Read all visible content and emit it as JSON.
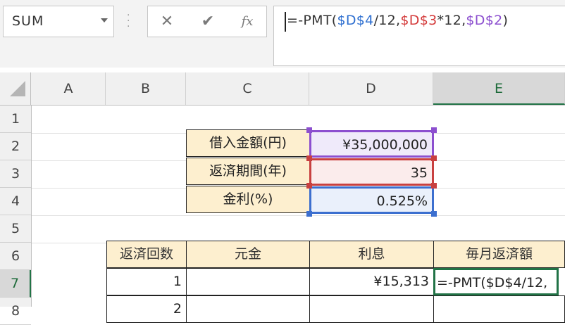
{
  "name_box": {
    "value": "SUM"
  },
  "formula_buttons": {
    "cancel": "✕",
    "enter": "✔",
    "fx": "fx"
  },
  "formula": {
    "parts": [
      "=-PMT(",
      "$D$4",
      "/12,",
      "$D$3",
      "*12,",
      "$D$2",
      ")"
    ]
  },
  "columns": [
    "A",
    "B",
    "C",
    "D",
    "E"
  ],
  "rows": [
    "1",
    "2",
    "3",
    "4",
    "5",
    "6",
    "7",
    "8"
  ],
  "loan_table": [
    {
      "label": "借入金額(円)",
      "value": "¥35,000,000"
    },
    {
      "label": "返済期間(年)",
      "value": "35"
    },
    {
      "label": "金利(%)",
      "value": "0.525%"
    }
  ],
  "schedule_headers": [
    "返済回数",
    "元金",
    "利息",
    "毎月返済額"
  ],
  "schedule_row_7": {
    "count": "1",
    "principal": "",
    "interest": "¥15,313",
    "payment_edit": "=-PMT($D$4/12,"
  },
  "schedule_row_8": {
    "count": "2"
  },
  "colors": {
    "accent_green": "#217346",
    "ref_purple": "#8c4fcf",
    "ref_red": "#c84040",
    "ref_blue": "#3c6fcf",
    "label_fill": "#fdefcf"
  }
}
